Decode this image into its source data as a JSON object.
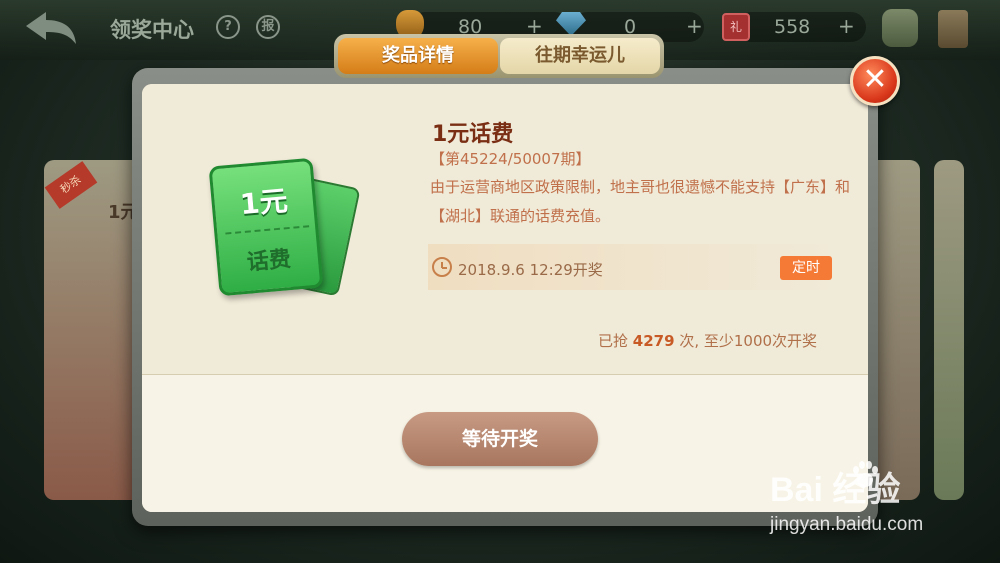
{
  "header": {
    "title": "领奖中心",
    "help_label": "?",
    "report_label": "报",
    "coins": "80",
    "gems": "0",
    "tickets": "558",
    "ticket_icon_text": "礼",
    "plus": "+"
  },
  "background": {
    "left_card_badge": "秒杀",
    "left_card_title": "1元"
  },
  "modal": {
    "tabs": [
      {
        "label": "奖品详情",
        "active": true
      },
      {
        "label": "往期幸运儿",
        "active": false
      }
    ],
    "close_label": "✕",
    "prize_card": {
      "amount": "1元",
      "kind": "话费"
    },
    "prize_name": "1元话费",
    "period": "【第45224/50007期】",
    "description": "由于运营商地区政策限制，地主哥也很遗憾不能支持【广东】和【湖北】联通的话费充值。",
    "draw_time": "2018.9.6  12:29开奖",
    "timed_badge": "定时",
    "grabbed_prefix": "已抢",
    "grabbed_count": "4279",
    "grabbed_suffix": "次, 至少1000次开奖",
    "wait_button": "等待开奖"
  },
  "watermark": {
    "logo": "Bai   经验",
    "url": "jingyan.baidu.com"
  },
  "colors": {
    "accent_orange": "#d47d18",
    "prize_green": "#2fae45",
    "title_brown": "#7a2e14",
    "timed_badge": "#f57a36"
  }
}
